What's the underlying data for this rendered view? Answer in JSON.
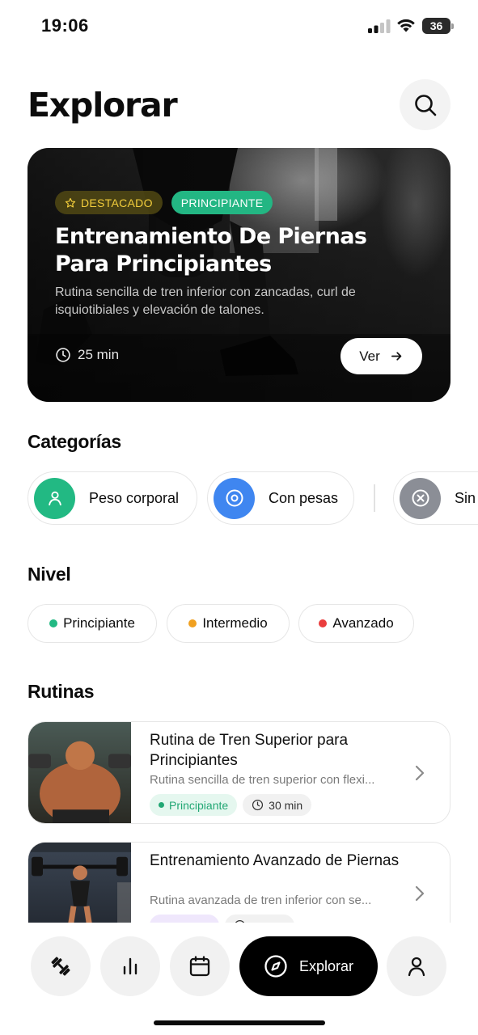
{
  "status_bar": {
    "time": "19:06",
    "battery": "36"
  },
  "header": {
    "title": "Explorar",
    "search_icon": "search-icon"
  },
  "featured": {
    "badge_featured": "DESTACADO",
    "badge_level": "PRINCIPIANTE",
    "title": "Entrenamiento De Piernas Para Principiantes",
    "description": "Rutina sencilla de tren inferior con zancadas, curl de isquiotibiales y elevación de talones.",
    "duration": "25 min",
    "cta": "Ver"
  },
  "categories": {
    "title": "Categorías",
    "items": [
      {
        "label": "Peso corporal",
        "icon": "person-icon",
        "color": "#22b983"
      },
      {
        "label": "Con pesas",
        "icon": "target-icon",
        "color": "#3f86f0"
      },
      {
        "label": "Sin",
        "icon": "close-circle-icon",
        "color": "#8b8e96"
      }
    ]
  },
  "levels": {
    "title": "Nivel",
    "items": [
      {
        "label": "Principiante",
        "color": "#22b983"
      },
      {
        "label": "Intermedio",
        "color": "#f0a020"
      },
      {
        "label": "Avanzado",
        "color": "#ea3d3d"
      }
    ]
  },
  "routines": {
    "title": "Rutinas",
    "items": [
      {
        "title": "Rutina de Tren Superior para Principiantes",
        "description": "Rutina sencilla de tren superior con flexi...",
        "level": "Principiante",
        "duration": "30 min"
      },
      {
        "title": "Entrenamiento Avanzado de Piernas",
        "description": "Rutina avanzada de tren inferior con se...",
        "level": "",
        "duration": ""
      }
    ]
  },
  "bottom_nav": {
    "items": [
      {
        "icon": "dumbbell-icon"
      },
      {
        "icon": "stats-icon"
      },
      {
        "icon": "calendar-icon"
      },
      {
        "icon": "compass-icon",
        "label": "Explorar",
        "active": true
      },
      {
        "icon": "profile-icon"
      }
    ]
  }
}
